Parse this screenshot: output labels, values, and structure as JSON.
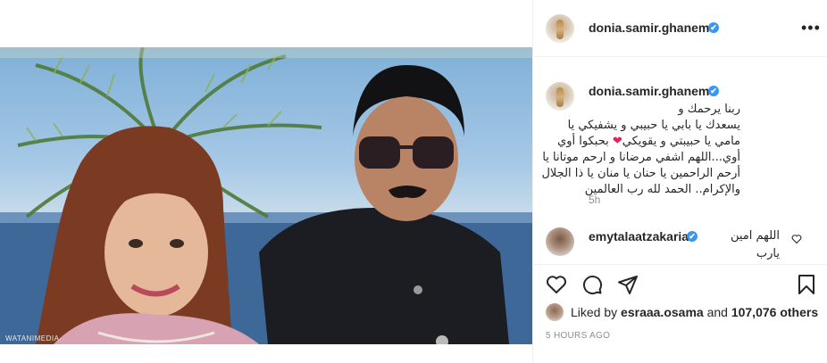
{
  "post": {
    "username": "donia.samir.ghanem",
    "verified_badge": "✔",
    "more_icon": "•••",
    "photo_watermark": "WATANIMEDIA",
    "caption": {
      "lines": [
        "ربنا يرحمك و",
        "يسعدك يا بابي يا حبيبي و يشفيكي يا",
        "مامي يا حبيبتي و يقويكي",
        "أوي...اللهم اشفي مرضانا و ارحم موتانا يا",
        "أرحم الراحمين يا حنان يا منان يا ذا الجلال",
        "والإكرام.. الحمد لله رب العالمين"
      ],
      "heart": "❤",
      "heart_after": " بحبكوا أوي",
      "time": "5h"
    },
    "comment": {
      "username": "emytalaatzakaria",
      "lines": [
        "اللهم امين",
        "يارب"
      ]
    },
    "likes": {
      "prefix": "Liked by ",
      "user": "esraaa.osama",
      "middle": " and ",
      "count": "107,076 others"
    },
    "timestamp": "5 HOURS AGO"
  },
  "colors": {
    "verified": "#3897f0",
    "heart": "#e0245e",
    "secondary_text": "#8e8e8e",
    "border": "#efefef"
  },
  "icons": [
    "more-icon",
    "heart-icon",
    "comment-icon",
    "share-icon",
    "bookmark-icon",
    "verified-icon"
  ]
}
